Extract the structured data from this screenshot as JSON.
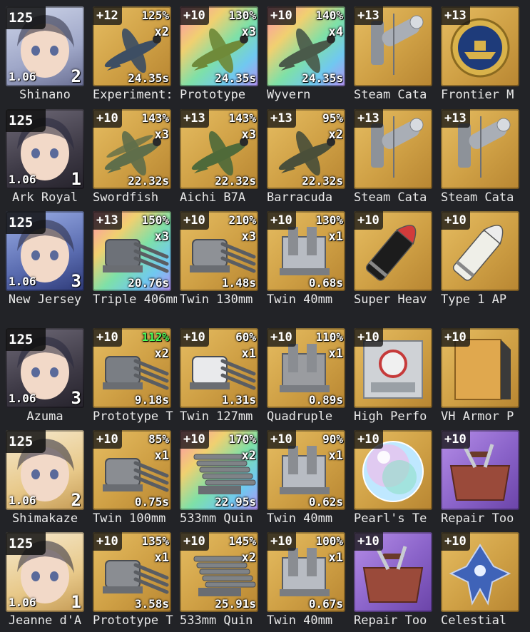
{
  "rows": [
    {
      "ship": {
        "level": "125",
        "stat": "1.06",
        "slots": "2",
        "name": "Shinano",
        "tone": ""
      },
      "items": [
        {
          "enh": "+12",
          "pct": "125%",
          "mult": "x2",
          "reload": "24.35s",
          "name": "Experiment:",
          "bg": "gold",
          "icon": "plane-icon",
          "color": "#3d4e63"
        },
        {
          "enh": "+10",
          "pct": "130%",
          "mult": "x3",
          "reload": "24.35s",
          "name": "Prototype",
          "bg": "rainbow",
          "icon": "plane-icon",
          "color": "#6f8a3a"
        },
        {
          "enh": "+10",
          "pct": "140%",
          "mult": "x4",
          "reload": "24.35s",
          "name": "Wyvern",
          "bg": "rainbow",
          "icon": "plane-icon",
          "color": "#4a5a4a"
        },
        {
          "enh": "+13",
          "pct": "",
          "mult": "",
          "reload": "",
          "name": "Steam Cata",
          "bg": "gold",
          "icon": "catapult-icon",
          "color": "#a9aeb6"
        },
        {
          "enh": "+13",
          "pct": "",
          "mult": "",
          "reload": "",
          "name": "Frontier M",
          "bg": "gold",
          "icon": "medal-icon",
          "color": "#1e3b7a"
        }
      ]
    },
    {
      "ship": {
        "level": "125",
        "stat": "1.06",
        "slots": "1",
        "name": "Ark Royal",
        "tone": "dark"
      },
      "items": [
        {
          "enh": "+10",
          "pct": "143%",
          "mult": "x3",
          "reload": "22.32s",
          "name": "Swordfish",
          "bg": "gold",
          "icon": "biplane-icon",
          "color": "#5f6e4a"
        },
        {
          "enh": "+13",
          "pct": "143%",
          "mult": "x3",
          "reload": "22.32s",
          "name": "Aichi B7A",
          "bg": "gold",
          "icon": "plane-icon",
          "color": "#4f6a3a"
        },
        {
          "enh": "+13",
          "pct": "95%",
          "mult": "x2",
          "reload": "22.32s",
          "name": "Barracuda",
          "bg": "gold",
          "icon": "plane-icon",
          "color": "#4a4f3a"
        },
        {
          "enh": "+13",
          "pct": "",
          "mult": "",
          "reload": "",
          "name": "Steam Cata",
          "bg": "gold",
          "icon": "catapult-icon",
          "color": "#a9aeb6"
        },
        {
          "enh": "+13",
          "pct": "",
          "mult": "",
          "reload": "",
          "name": "Steam Cata",
          "bg": "gold",
          "icon": "catapult-icon",
          "color": "#a9aeb6"
        }
      ]
    },
    {
      "ship": {
        "level": "125",
        "stat": "1.06",
        "slots": "3",
        "name": "New Jersey",
        "tone": "blue"
      },
      "items": [
        {
          "enh": "+13",
          "pct": "150%",
          "mult": "x3",
          "reload": "20.76s",
          "name": "Triple 406mm",
          "bg": "rainbow",
          "icon": "turret-icon",
          "color": "#6d7178"
        },
        {
          "enh": "+10",
          "pct": "210%",
          "mult": "x3",
          "reload": "1.48s",
          "name": "Twin 130mm",
          "bg": "gold",
          "icon": "turret-icon",
          "color": "#8e9196"
        },
        {
          "enh": "+10",
          "pct": "130%",
          "mult": "x1",
          "reload": "0.68s",
          "name": "Twin 40mm",
          "bg": "gold",
          "icon": "aa-gun-icon",
          "color": "#b8bcc3"
        },
        {
          "enh": "+10",
          "pct": "",
          "mult": "",
          "reload": "",
          "name": "Super Heav",
          "bg": "gold",
          "icon": "shell-icon",
          "color": "#1c1c1c"
        },
        {
          "enh": "+10",
          "pct": "",
          "mult": "",
          "reload": "",
          "name": "Type 1 AP",
          "bg": "gold",
          "icon": "shell-icon",
          "color": "#efefe8"
        }
      ]
    },
    {
      "ship": {
        "level": "125",
        "stat": "1.06",
        "slots": "3",
        "name": "Azuma",
        "tone": "dark"
      },
      "items": [
        {
          "enh": "+10",
          "pct": "112%",
          "pctColor": "green",
          "mult": "x2",
          "reload": "9.18s",
          "name": "Prototype T",
          "bg": "gold",
          "icon": "turret-icon",
          "color": "#7a7e84"
        },
        {
          "enh": "+10",
          "pct": "60%",
          "mult": "x1",
          "reload": "1.31s",
          "name": "Twin 127mm",
          "bg": "gold",
          "icon": "turret-icon",
          "color": "#e9eaec"
        },
        {
          "enh": "+10",
          "pct": "110%",
          "mult": "x1",
          "reload": "0.89s",
          "name": "Quadruple",
          "bg": "gold",
          "icon": "aa-gun-icon",
          "color": "#9a9ca0"
        },
        {
          "enh": "+10",
          "pct": "",
          "mult": "",
          "reload": "",
          "name": "High Perfo",
          "bg": "gold",
          "icon": "machine-icon",
          "color": "#cfd2d6"
        },
        {
          "enh": "+10",
          "pct": "",
          "mult": "",
          "reload": "",
          "name": "VH Armor P",
          "bg": "gold",
          "icon": "armor-icon",
          "color": "#e0a84e"
        }
      ]
    },
    {
      "ship": {
        "level": "125",
        "stat": "1.06",
        "slots": "2",
        "name": "Shimakaze",
        "tone": "light"
      },
      "items": [
        {
          "enh": "+10",
          "pct": "85%",
          "mult": "x1",
          "reload": "0.75s",
          "name": "Twin 100mm",
          "bg": "gold",
          "icon": "turret-icon",
          "color": "#8a8d92"
        },
        {
          "enh": "+10",
          "pct": "170%",
          "mult": "x2",
          "reload": "22.95s",
          "name": "533mm Quin",
          "bg": "rainbow",
          "icon": "torpedo-icon",
          "color": "#7f8387"
        },
        {
          "enh": "+10",
          "pct": "90%",
          "mult": "x1",
          "reload": "0.62s",
          "name": "Twin 40mm",
          "bg": "gold",
          "icon": "aa-gun-icon",
          "color": "#b8bcc3"
        },
        {
          "enh": "+10",
          "pct": "",
          "mult": "",
          "reload": "",
          "name": "Pearl's Te",
          "bg": "gold",
          "icon": "orb-icon",
          "color": "#c7f0ff"
        },
        {
          "enh": "+10",
          "pct": "",
          "mult": "",
          "reload": "",
          "name": "Repair Too",
          "bg": "purple",
          "icon": "toolbox-icon",
          "color": "#9a4a3a"
        }
      ]
    },
    {
      "ship": {
        "level": "125",
        "stat": "1.06",
        "slots": "1",
        "name": "Jeanne d'A",
        "tone": "light"
      },
      "items": [
        {
          "enh": "+10",
          "pct": "135%",
          "mult": "x1",
          "reload": "3.58s",
          "name": "Prototype T",
          "bg": "gold",
          "icon": "turret-icon",
          "color": "#8a8d92"
        },
        {
          "enh": "+10",
          "pct": "145%",
          "mult": "x2",
          "reload": "25.91s",
          "name": "533mm Quin",
          "bg": "gold",
          "icon": "torpedo-icon",
          "color": "#7f8387"
        },
        {
          "enh": "+10",
          "pct": "100%",
          "mult": "x1",
          "reload": "0.67s",
          "name": "Twin 40mm",
          "bg": "gold",
          "icon": "aa-gun-icon",
          "color": "#b8bcc3"
        },
        {
          "enh": "+10",
          "pct": "",
          "mult": "",
          "reload": "",
          "name": "Repair Too",
          "bg": "purple",
          "icon": "toolbox-icon",
          "color": "#9a4a3a"
        },
        {
          "enh": "+10",
          "pct": "",
          "mult": "",
          "reload": "",
          "name": "Celestial",
          "bg": "gold",
          "icon": "celestial-icon",
          "color": "#3f63b8"
        }
      ]
    }
  ]
}
